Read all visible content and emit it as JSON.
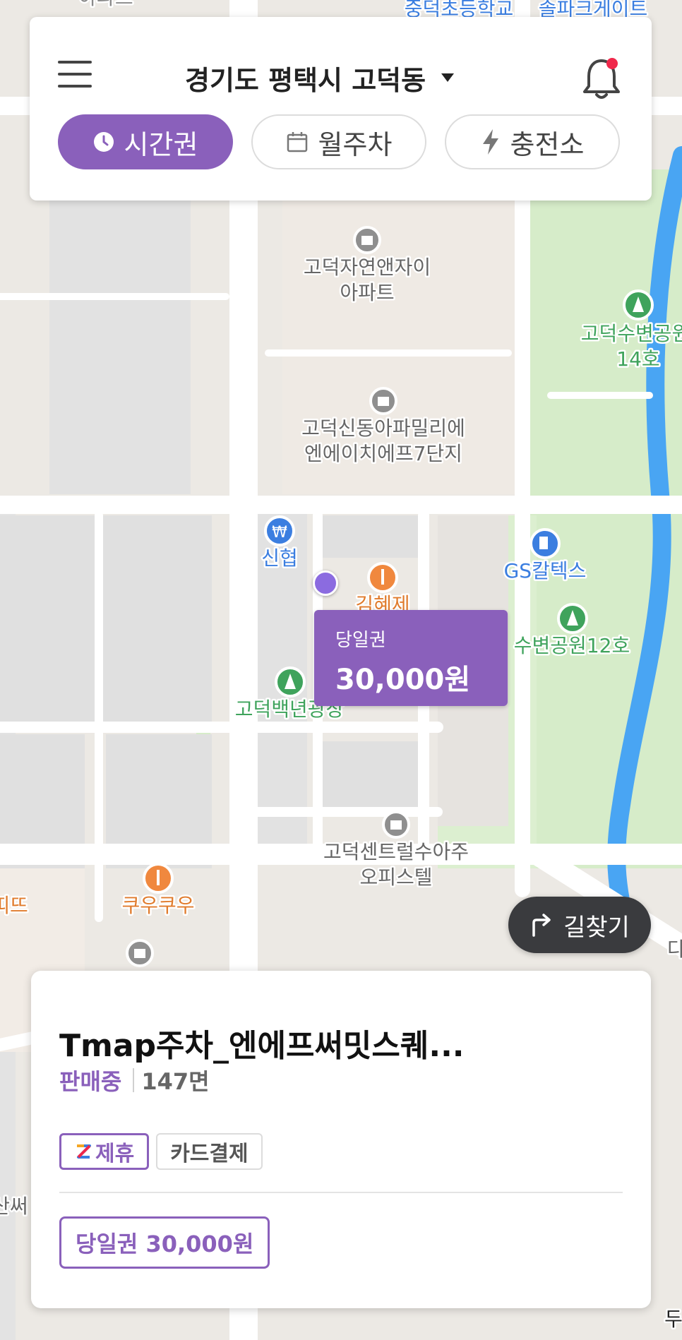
{
  "header": {
    "location": "경기도 평택시 고덕동",
    "tabs": [
      {
        "label": "시간권",
        "icon": "clock-icon",
        "active": true
      },
      {
        "label": "월주차",
        "icon": "calendar-icon",
        "active": false
      },
      {
        "label": "충전소",
        "icon": "lightning-icon",
        "active": false
      }
    ]
  },
  "map": {
    "labels": {
      "top_left": "아파트",
      "top_center": "중덕초등학교",
      "top_right": "솔파크게이트",
      "apt1_a": "고덕자연앤자이",
      "apt1_b": "아파트",
      "park14_a": "고덕수변공원",
      "park14_b": "14호",
      "apt2_a": "고덕신동아파밀리에",
      "apt2_b": "엔에이치에프7단지",
      "bank": "신협",
      "gas": "GS칼텍스",
      "restaurant": "김혜제",
      "park12": "수변공원12호",
      "square": "고덕백년광장",
      "office_a": "고덕센트럴수아주",
      "office_b": "오피스텔",
      "cafe": "쿠우쿠우",
      "edge_left1": "띠뜨",
      "edge_left2": "산써",
      "edge_right": "다",
      "edge_bottom": "두"
    },
    "colors": {
      "base": "#ece9e4",
      "green": "#d6ecc9",
      "water": "#49a5f3",
      "road": "#ffffff",
      "accent": "#8a60bb"
    }
  },
  "marker": {
    "label": "당일권",
    "price": "30,000원"
  },
  "route_button": {
    "label": "길찾기",
    "icon": "turn-right-icon"
  },
  "lot": {
    "name": "Tmap주차_엔에프써밋스퀘...",
    "status": "판매중",
    "spaces": "147면",
    "badges": {
      "partner": "제휴",
      "payment": "카드결제"
    },
    "ticket": "당일권 30,000원"
  }
}
